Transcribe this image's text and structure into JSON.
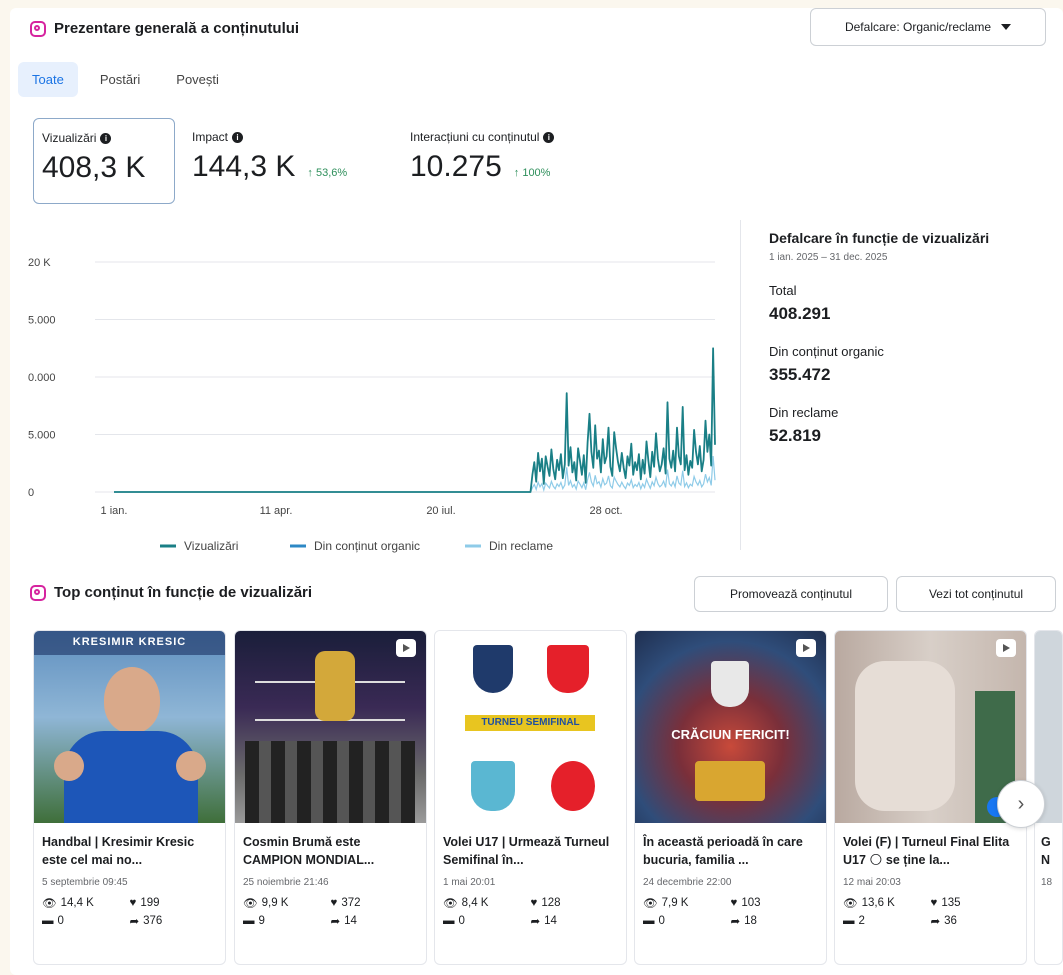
{
  "header": {
    "title": "Prezentare generală a conținutului",
    "breakdown_dropdown": "Defalcare: Organic/reclame"
  },
  "tabs": [
    {
      "label": "Toate"
    },
    {
      "label": "Postări"
    },
    {
      "label": "Povești"
    }
  ],
  "metrics": [
    {
      "label": "Vizualizări",
      "value": "408,3 K",
      "change": ""
    },
    {
      "label": "Impact",
      "value": "144,3 K",
      "change": "↑ 53,6%"
    },
    {
      "label": "Interacțiuni cu conținutul",
      "value": "10.275",
      "change": "↑ 100%"
    }
  ],
  "chart_data": {
    "type": "line",
    "title": "",
    "x_ticks": [
      "1 ian.",
      "11 apr.",
      "20 iul.",
      "28 oct."
    ],
    "y_ticks": [
      "20 K",
      "5.000",
      "0.000",
      "5.000",
      "0"
    ],
    "ylim": [
      0,
      20000
    ],
    "legend_placement": "bottom",
    "series": [
      {
        "name": "Vizualizări",
        "color": "#1a7f86",
        "values": [
          0,
          0,
          0,
          0,
          0,
          0,
          0,
          0,
          0,
          0,
          0,
          0,
          0,
          0,
          0,
          0,
          0,
          0,
          0,
          0,
          0,
          0,
          0,
          0,
          0,
          0,
          0,
          0,
          0,
          0,
          0,
          0,
          0,
          0,
          0,
          0,
          0,
          0,
          0,
          0,
          0,
          0,
          0,
          0,
          0,
          0,
          0,
          0,
          0,
          0,
          0,
          0,
          0,
          0,
          0,
          0,
          0,
          0,
          0,
          0,
          0,
          0,
          0,
          0,
          0,
          0,
          0,
          0,
          0,
          0,
          0,
          0,
          0,
          0,
          0,
          0,
          0,
          0,
          0,
          0,
          0,
          0,
          0,
          0,
          0,
          0,
          0,
          0,
          0,
          0,
          0,
          0,
          0,
          0,
          0,
          0,
          0,
          0,
          0,
          0,
          0,
          0,
          0,
          0,
          0,
          0,
          0,
          0,
          0,
          0,
          0,
          0,
          0,
          0,
          0,
          0,
          0,
          0,
          0,
          0,
          0,
          0,
          0,
          0,
          0,
          0,
          0,
          0,
          0,
          0,
          0,
          0,
          0,
          0,
          0,
          0,
          0,
          0,
          0,
          0,
          0,
          0,
          0,
          0,
          0,
          0,
          0,
          0,
          0,
          0,
          0,
          0,
          0,
          0,
          0,
          0,
          0,
          0,
          0,
          0,
          0,
          0,
          0,
          0,
          0,
          0,
          0,
          0,
          0,
          0,
          0,
          0,
          0,
          0,
          0,
          0,
          0,
          0,
          0,
          0,
          0,
          0,
          0,
          0,
          0,
          0,
          0,
          0,
          0,
          0,
          0,
          0,
          0,
          0,
          0,
          0,
          0,
          0,
          0,
          0,
          0,
          0,
          0,
          0,
          0,
          0,
          0,
          0,
          0,
          0,
          0,
          0,
          0,
          0,
          0,
          0,
          0,
          0,
          0,
          0,
          1500,
          2600,
          900,
          3400,
          1800,
          2900,
          700,
          3100,
          2200,
          1400,
          3700,
          2000,
          1100,
          2800,
          1900,
          3300,
          1200,
          2400,
          8600,
          2300,
          3900,
          1700,
          2600,
          1000,
          3800,
          2700,
          1500,
          3200,
          800,
          4300,
          6800,
          3500,
          2100,
          5800,
          2900,
          3600,
          1700,
          4600,
          2500,
          3100,
          5600,
          2200,
          1400,
          5200,
          3800,
          2600,
          1800,
          3400,
          2100,
          1200,
          3100,
          2300,
          4200,
          1500,
          2600,
          1900,
          3300,
          1100,
          2800,
          1600,
          4400,
          2700,
          1300,
          3500,
          2200,
          5100,
          2900,
          1800,
          2400,
          3800,
          1600,
          7800,
          2900,
          2100,
          3600,
          1800,
          5600,
          3100,
          2400,
          7400,
          1900,
          3200,
          1500,
          2700,
          2100,
          5400,
          3500,
          2400,
          4000,
          1800,
          2800,
          6200,
          3500,
          5000,
          2300,
          12500,
          4100
        ]
      },
      {
        "name": "Din conținut organic",
        "color": "#2d88c5",
        "values": []
      },
      {
        "name": "Din reclame",
        "color": "#8ecbe8",
        "values": []
      }
    ]
  },
  "breakdown": {
    "title": "Defalcare în funcție de vizualizări",
    "date_range": "1 ian. 2025 – 31 dec. 2025",
    "total_label": "Total",
    "total_value": "408.291",
    "organic_label": "Din conținut organic",
    "organic_value": "355.472",
    "ads_label": "Din reclame",
    "ads_value": "52.819"
  },
  "top": {
    "title": "Top conținut în funcție de vizualizări",
    "promote_button": "Promovează conținutul",
    "see_all_button": "Vezi tot conținutul"
  },
  "cards": [
    {
      "thumb_text": "KRESIMIR KRESIC",
      "title": "Handbal | Kresimir Kresic este cel mai no...",
      "date": "5 septembrie 09:45",
      "views": "14,4 K",
      "likes": "199",
      "comments": "0",
      "shares": "376"
    },
    {
      "thumb_text": "",
      "title": "Cosmin Brumă este CAMPION MONDIAL...",
      "date": "25 noiembrie 21:46",
      "views": "9,9 K",
      "likes": "372",
      "comments": "9",
      "shares": "14"
    },
    {
      "thumb_text": "TURNEU SEMIFINAL",
      "title": "Volei U17 | Urmează Turneul Semifinal în...",
      "date": "1 mai 20:01",
      "views": "8,4 K",
      "likes": "128",
      "comments": "0",
      "shares": "14"
    },
    {
      "thumb_text": "CRĂCIUN FERICIT!",
      "title": "În această perioadă în care bucuria, familia ...",
      "date": "24 decembrie 22:00",
      "views": "7,9 K",
      "likes": "103",
      "comments": "0",
      "shares": "18"
    },
    {
      "thumb_text": "",
      "title": "Volei (F) | Turneul Final Elita U17 🌕 se ține la...",
      "date": "12 mai 20:03",
      "views": "13,6 K",
      "likes": "135",
      "comments": "2",
      "shares": "36"
    }
  ],
  "partial_card": {
    "title_line1": "G",
    "title_line2": "N",
    "date": "18"
  }
}
